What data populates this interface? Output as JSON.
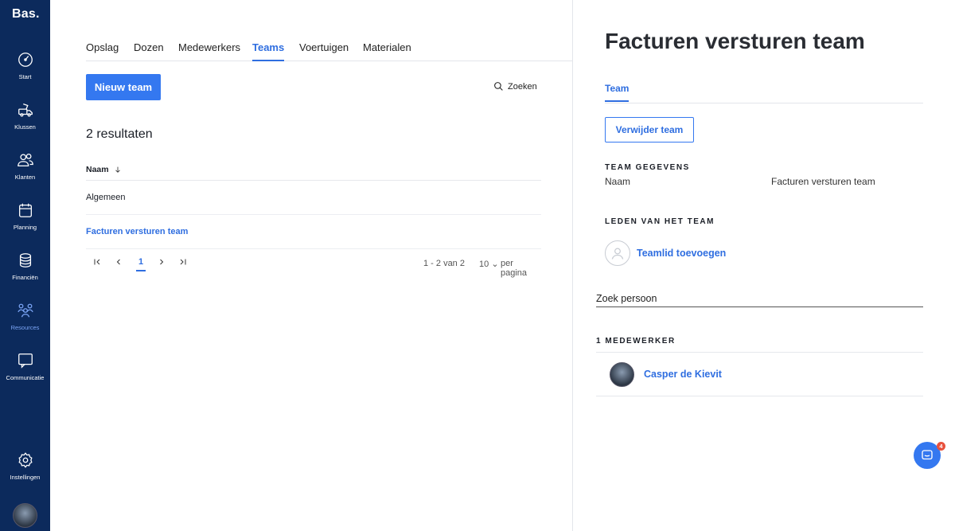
{
  "sidebar": {
    "logo": "Bas",
    "logo_dot": ".",
    "items": [
      {
        "label": "Start",
        "icon": "dashboard-icon"
      },
      {
        "label": "Klussen",
        "icon": "jobs-icon"
      },
      {
        "label": "Klanten",
        "icon": "customers-icon"
      },
      {
        "label": "Planning",
        "icon": "calendar-icon"
      },
      {
        "label": "Financiën",
        "icon": "coins-icon"
      },
      {
        "label": "Resources",
        "icon": "resources-icon",
        "active": true
      },
      {
        "label": "Communicatie",
        "icon": "chat-icon"
      },
      {
        "label": "Instellingen",
        "icon": "gear-icon"
      }
    ]
  },
  "tabs": [
    {
      "label": "Opslag"
    },
    {
      "label": "Dozen"
    },
    {
      "label": "Medewerkers"
    },
    {
      "label": "Teams",
      "active": true
    },
    {
      "label": "Voertuigen"
    },
    {
      "label": "Materialen"
    }
  ],
  "toolbar": {
    "new_team_label": "Nieuw team",
    "search_label": "Zoeken"
  },
  "results_label": "2 resultaten",
  "table": {
    "column_name": "Naam",
    "rows": [
      "Algemeen",
      "Facturen versturen team"
    ]
  },
  "pagination": {
    "current_page": "1",
    "range": "1 - 2 van 2",
    "page_size": "10",
    "per_page_label": "per pagina"
  },
  "panel": {
    "title": "Facturen versturen team",
    "tab": "Team",
    "delete_button": "Verwijder team",
    "details_heading": "TEAM GEGEVENS",
    "name_key": "Naam",
    "name_value": "Facturen versturen team",
    "members_heading": "LEDEN VAN HET TEAM",
    "add_member": "Teamlid toevoegen",
    "search_placeholder": "Zoek persoon",
    "employee_count_heading": "1 MEDEWERKER",
    "members": [
      "Casper de Kievit"
    ]
  },
  "chat_widget": {
    "badge": "4"
  },
  "colors": {
    "sidebar": "#0c2a5c",
    "accent": "#3478f0",
    "badge": "#e8513d"
  }
}
